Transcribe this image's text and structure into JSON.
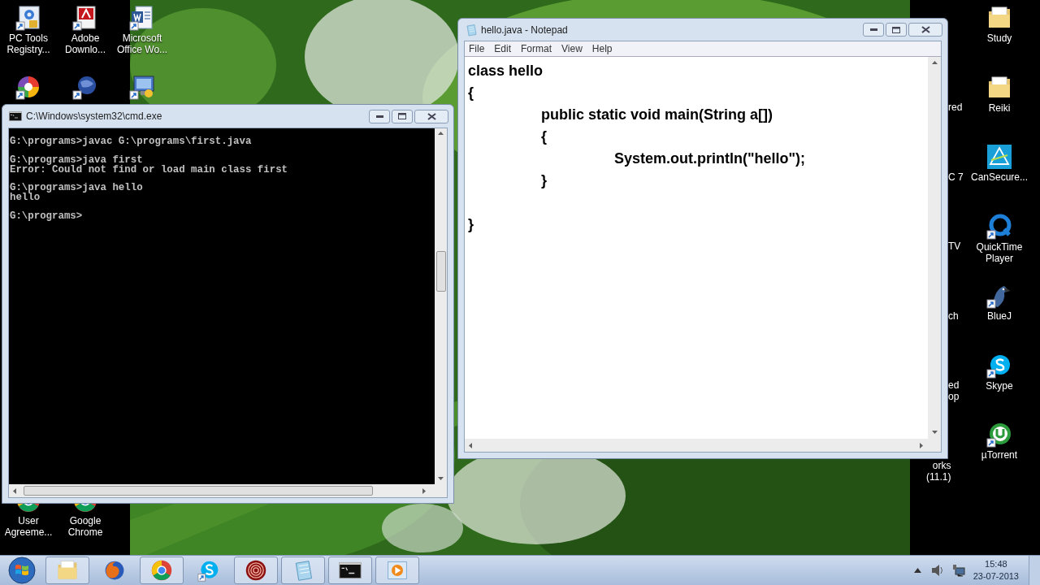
{
  "desktop": {
    "left_icons": [
      {
        "kind": "gear",
        "label": [
          "PC Tools",
          "Registry..."
        ]
      },
      {
        "kind": "adobe",
        "label": [
          "Adobe",
          "Downlo..."
        ]
      },
      {
        "kind": "word",
        "label": [
          "Microsoft",
          "Office Wo..."
        ]
      },
      {
        "kind": "pinwheel"
      },
      {
        "kind": "globe"
      },
      {
        "kind": "monitor"
      },
      {
        "kind": "chrome",
        "label": [
          "User",
          "Agreeme..."
        ]
      },
      {
        "kind": "chrome",
        "label": [
          "Google",
          "Chrome"
        ]
      }
    ],
    "right_icons": [
      {
        "kind": "folder",
        "label": [
          "Study"
        ]
      },
      {
        "kind": "folder",
        "label": [
          "Reiki"
        ]
      },
      {
        "kind": "triangle",
        "label": [
          "CanSecure..."
        ]
      },
      {
        "kind": "quicktime",
        "label": [
          "QuickTime",
          "Player"
        ]
      },
      {
        "kind": "bird",
        "label": [
          "BlueJ"
        ]
      },
      {
        "kind": "skype",
        "label": [
          "Skype"
        ]
      },
      {
        "kind": "torrent",
        "label": [
          "µTorrent"
        ]
      }
    ],
    "partial_labels": [
      {
        "lines": [
          "red"
        ]
      },
      {
        "lines": [
          "C 7"
        ]
      },
      {
        "lines": [
          "TV"
        ]
      },
      {
        "lines": [
          "ch"
        ]
      },
      {
        "lines": [
          "ed",
          "op"
        ]
      },
      {
        "lines": [
          "orks",
          "(11.1)"
        ]
      }
    ]
  },
  "cmd_window": {
    "title": "C:\\Windows\\system32\\cmd.exe",
    "output_blocks": [
      [
        "G:\\programs>javac G:\\programs\\first.java"
      ],
      [
        "G:\\programs>java first",
        "Error: Could not find or load main class first"
      ],
      [
        "G:\\programs>java hello",
        "hello"
      ],
      [
        "G:\\programs>"
      ]
    ]
  },
  "notepad_window": {
    "title": "hello.java - Notepad",
    "menu": [
      "File",
      "Edit",
      "Format",
      "View",
      "Help"
    ],
    "text": "class hello\n{\n\tpublic static void main(String a[])\n\t{\n\t\tSystem.out.println(\"hello\");\n\t}\n\n}"
  },
  "taskbar": {
    "items": [
      {
        "kind": "folder",
        "running": true
      },
      {
        "kind": "firefox",
        "running": false
      },
      {
        "kind": "chrome",
        "running": true
      },
      {
        "kind": "skype",
        "running": false
      },
      {
        "kind": "target",
        "running": true
      },
      {
        "kind": "notepad",
        "running": true
      },
      {
        "kind": "cmd",
        "running": true
      },
      {
        "kind": "media",
        "running": true
      }
    ],
    "clock": {
      "time": "15:48",
      "date": "23-07-2013"
    }
  }
}
